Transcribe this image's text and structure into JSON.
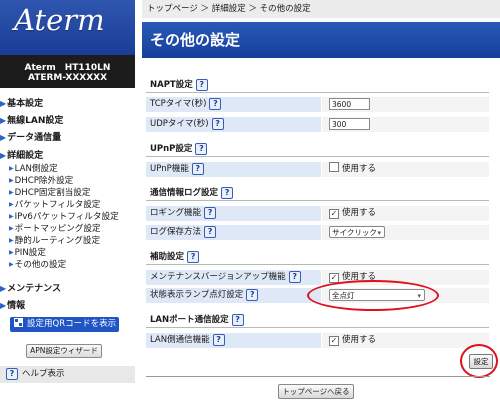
{
  "sidebar": {
    "logo": "Aterm",
    "model_line1": "Aterm　HT110LN",
    "model_line2": "ATERM-XXXXXX",
    "nav": {
      "basic": "基本設定",
      "wireless": "無線LAN設定",
      "data_usage": "データ通信量",
      "detail": "詳細設定",
      "lan": "LAN側設定",
      "dhcp_exclude": "DHCP除外設定",
      "dhcp_fixed": "DHCP固定割当設定",
      "packet_filter": "パケットフィルタ設定",
      "ipv6_filter": "IPv6パケットフィルタ設定",
      "port_mapping": "ポートマッピング設定",
      "static_routing": "静的ルーティング設定",
      "pin": "PIN設定",
      "other": "その他の設定",
      "maintenance": "メンテナンス",
      "info": "情報"
    },
    "qr_button": "設定用QRコードを表示",
    "apn_button": "APN設定ウィザード",
    "help": "ヘルプ表示"
  },
  "main": {
    "breadcrumb": "トップページ ＞ 詳細設定 ＞ その他の設定",
    "title": "その他の設定",
    "sections": {
      "napt": {
        "title": "NAPT設定",
        "tcp_label": "TCPタイマ(秒)",
        "tcp_value": "3600",
        "udp_label": "UDPタイマ(秒)",
        "udp_value": "300"
      },
      "upnp": {
        "title": "UPnP設定",
        "func_label": "UPnP機能",
        "use_label": "使用する",
        "checked": false
      },
      "log": {
        "title": "通信情報ログ設定",
        "logging_label": "ロギング機能",
        "logging_use": "使用する",
        "logging_checked": true,
        "method_label": "ログ保存方法",
        "method_value": "サイクリック"
      },
      "assist": {
        "title": "補助設定",
        "update_label": "メンテナンスバージョンアップ機能",
        "update_use": "使用する",
        "update_checked": true,
        "lamp_label": "状態表示ランプ点灯設定",
        "lamp_value": "全点灯"
      },
      "lanport": {
        "title": "LANポート通信設定",
        "lan_label": "LAN側通信機能",
        "lan_use": "使用する",
        "lan_checked": true
      }
    },
    "apply_button": "設定",
    "back_button": "トップページへ戻る"
  },
  "icons": {
    "help": "?",
    "check": "✓",
    "arrow": "▶",
    "chevron": "⌄"
  },
  "colors": {
    "brand_blue": "#1f55c4",
    "label_bg": "#dfe8f6",
    "highlight_red": "#e0101a"
  }
}
